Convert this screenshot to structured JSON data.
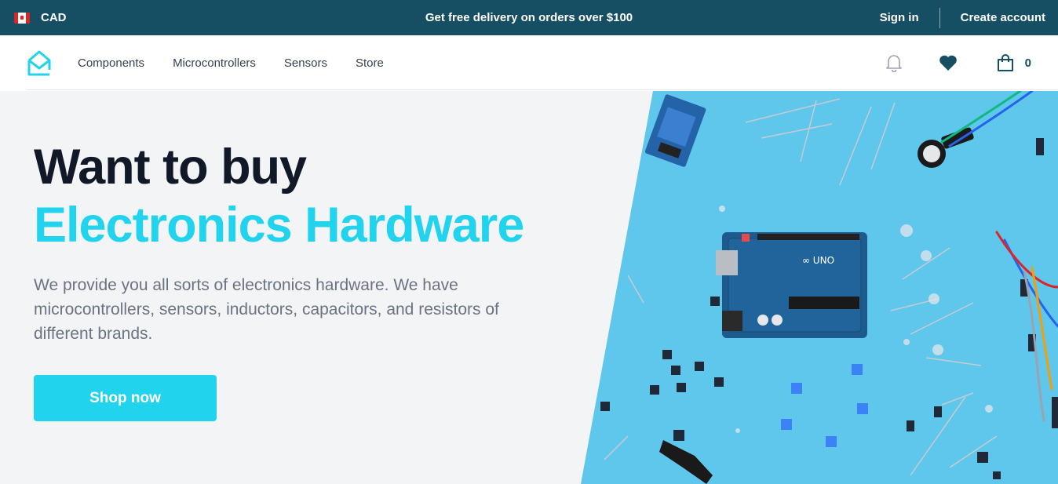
{
  "topbar": {
    "currency": "CAD",
    "flag_icon": "canada-flag-icon",
    "promo": "Get free delivery on orders over $100",
    "sign_in": "Sign in",
    "create_account": "Create account",
    "background": "#164e63"
  },
  "nav": {
    "logo_icon": "envelope-logo-icon",
    "links": [
      "Components",
      "Microcontrollers",
      "Sensors",
      "Store"
    ],
    "icons": [
      "bell-icon",
      "heart-icon",
      "shopping-bag-icon"
    ],
    "cart_count": "0"
  },
  "hero": {
    "title_line1": "Want to buy",
    "title_line2": "Electronics Hardware",
    "description": "We provide you all sorts of electronics hardware. We have microcontrollers, sensors, inductors, capacitors, and resistors of different brands.",
    "cta": "Shop now",
    "accent": "#22d3ee",
    "image_background": "#5fc6ec"
  }
}
